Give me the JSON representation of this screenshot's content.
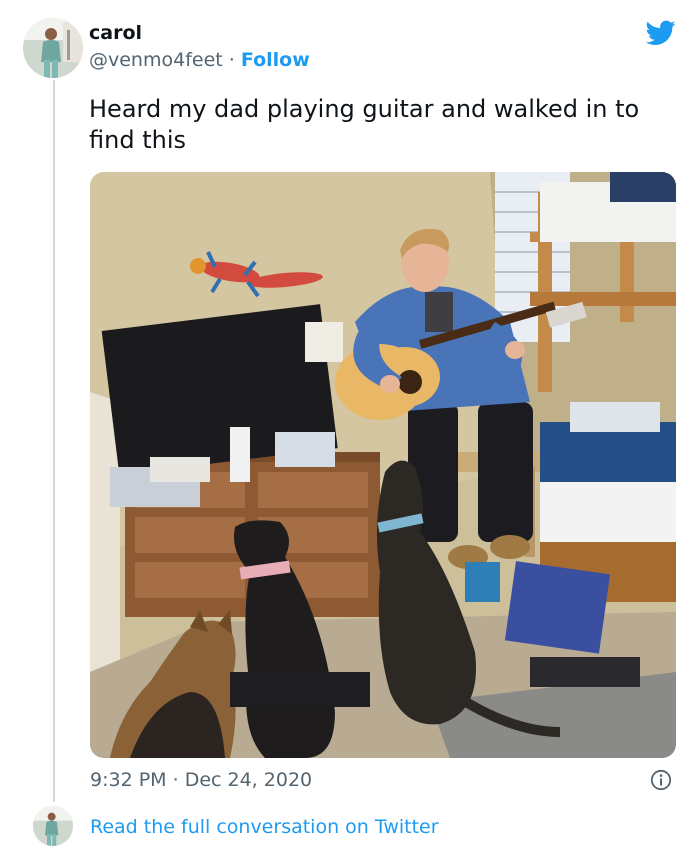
{
  "tweet": {
    "author": {
      "display_name": "carol",
      "handle": "@venmo4feet",
      "separator": "·",
      "follow_label": "Follow"
    },
    "logo_icon": "twitter-bird-icon",
    "text": "Heard my dad playing guitar and walked in to find this",
    "photo": {
      "subject": "man-playing-guitar-with-dogs"
    },
    "meta": {
      "time": "9:32 PM",
      "separator": "·",
      "date": "Dec 24, 2020"
    },
    "info_icon": "info-icon"
  },
  "footer": {
    "read_link": "Read the full conversation on Twitter"
  },
  "colors": {
    "accent": "#1d9bf0",
    "text_primary": "#0f1419",
    "text_secondary": "#536471",
    "thread_line": "#cfd9de"
  }
}
